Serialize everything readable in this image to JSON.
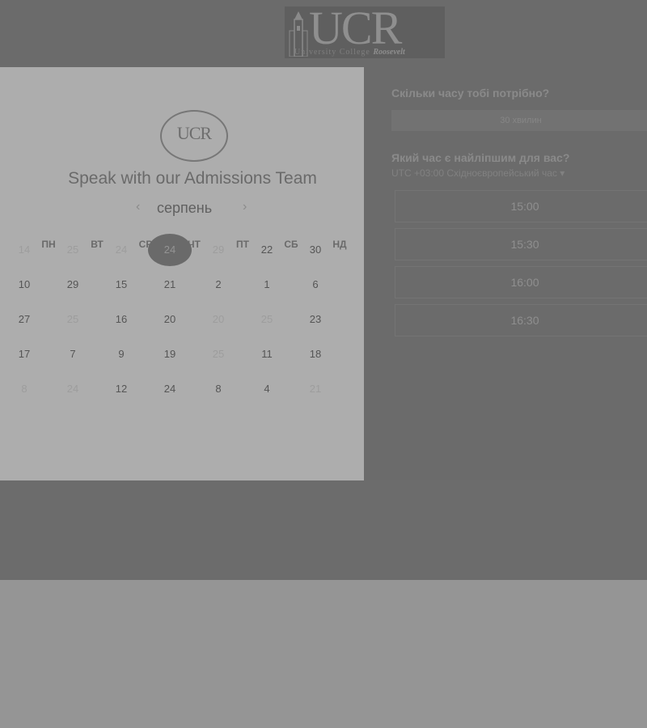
{
  "header": {
    "logo_letters": "UCR",
    "logo_subtitle": "University College",
    "logo_script": "Roosevelt"
  },
  "left_panel": {
    "circle_logo_text": "UCR",
    "title": "Speak with our Admissions Team",
    "month": "серпень",
    "weekdays": [
      "ПН",
      "ВТ",
      "СР",
      "ЧТ",
      "ПТ",
      "СБ",
      "НД"
    ],
    "weeks": [
      [
        {
          "d": "14",
          "m": true
        },
        {
          "d": "25",
          "m": true
        },
        {
          "d": "24",
          "m": true
        },
        {
          "d": "24",
          "s": true
        },
        {
          "d": "29",
          "m": true
        },
        {
          "d": "22"
        },
        {
          "d": "30"
        }
      ],
      [
        {
          "d": "10"
        },
        {
          "d": "29"
        },
        {
          "d": "15"
        },
        {
          "d": "21"
        },
        {
          "d": "2"
        },
        {
          "d": "1"
        },
        {
          "d": "6"
        }
      ],
      [
        {
          "d": "27"
        },
        {
          "d": "25",
          "m": true
        },
        {
          "d": "16"
        },
        {
          "d": "20"
        },
        {
          "d": "20",
          "m": true
        },
        {
          "d": "25",
          "m": true
        },
        {
          "d": "23"
        }
      ],
      [
        {
          "d": "17"
        },
        {
          "d": "7"
        },
        {
          "d": "9"
        },
        {
          "d": "19"
        },
        {
          "d": "25",
          "m": true
        },
        {
          "d": "11"
        },
        {
          "d": "18"
        }
      ],
      [
        {
          "d": "8",
          "m": true
        },
        {
          "d": "24",
          "m": true
        },
        {
          "d": "12"
        },
        {
          "d": "24"
        },
        {
          "d": "8"
        },
        {
          "d": "4"
        },
        {
          "d": "21",
          "m": true
        }
      ]
    ]
  },
  "right_panel": {
    "duration_question": "Скільки часу тобі потрібно?",
    "duration_value": "30 хвилин",
    "time_question": "Який час є найліпшим для вас?",
    "timezone": "UTC +03:00 Східноєвропейський час",
    "timezone_icon": "caret-down-icon",
    "slots": [
      "15:00",
      "15:30",
      "16:00",
      "16:30"
    ]
  },
  "colors": {
    "header_bg": "#6b6b6b",
    "left_panel_bg": "#adadad",
    "right_panel_bg": "#6b6b6b",
    "selected_day_bg": "#6a6a6a"
  }
}
